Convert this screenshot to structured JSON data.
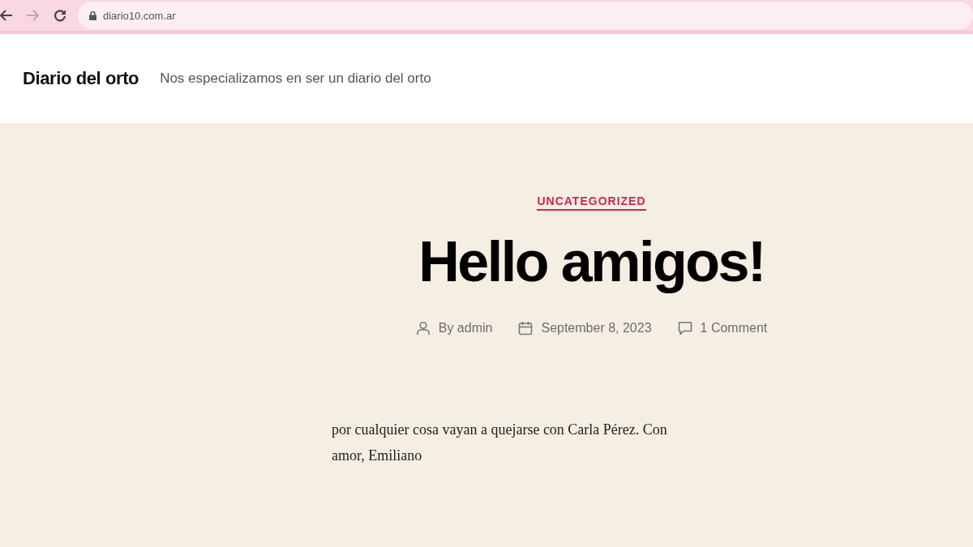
{
  "browser": {
    "url": "diario10.com.ar"
  },
  "site_header": {
    "title": "Diario del orto",
    "tagline": "Nos especializamos en ser un diario del orto"
  },
  "post": {
    "category": "UNCATEGORIZED",
    "title": "Hello amigos!",
    "meta": [
      {
        "kind": "author",
        "text": "By admin"
      },
      {
        "kind": "date",
        "text": "September 8, 2023"
      },
      {
        "kind": "comments",
        "text": "1 Comment"
      }
    ],
    "body": "por cualquier cosa vayan a quejarse con Carla Pérez. Con amor, Emiliano"
  }
}
